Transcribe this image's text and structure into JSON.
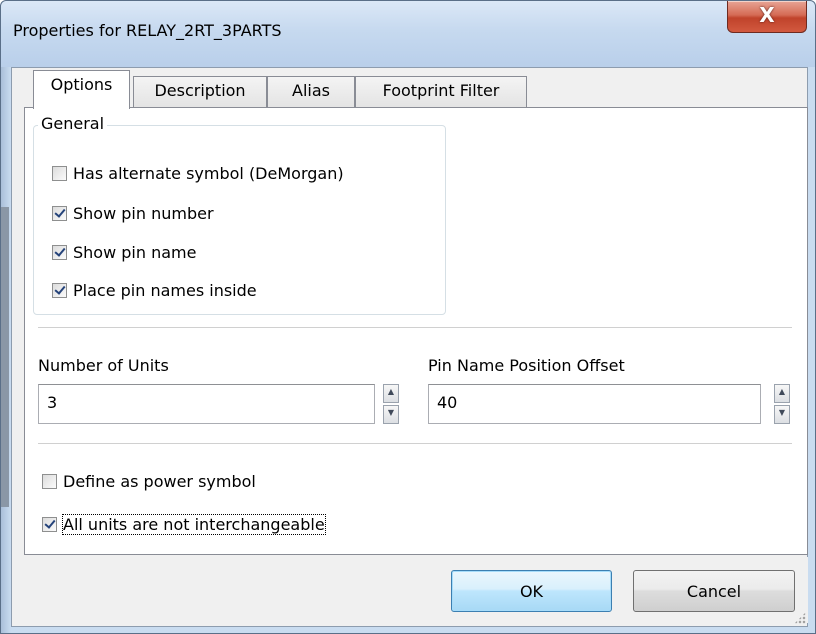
{
  "window": {
    "title": "Properties for RELAY_2RT_3PARTS",
    "close_glyph": "X"
  },
  "tabs": [
    {
      "label": "Options",
      "active": true
    },
    {
      "label": "Description",
      "active": false
    },
    {
      "label": "Alias",
      "active": false
    },
    {
      "label": "Footprint Filter",
      "active": false
    }
  ],
  "general": {
    "group_label": "General",
    "options": [
      {
        "label": "Has alternate symbol (DeMorgan)",
        "checked": false
      },
      {
        "label": "Show pin number",
        "checked": true
      },
      {
        "label": "Show pin name",
        "checked": true
      },
      {
        "label": "Place pin names inside",
        "checked": true
      }
    ]
  },
  "units": {
    "label": "Number of Units",
    "value": "3"
  },
  "pin_offset": {
    "label": "Pin Name Position Offset",
    "value": "40"
  },
  "power": {
    "label": "Define as power symbol",
    "checked": false
  },
  "interchangeable": {
    "label": "All units are not interchangeable",
    "checked": true
  },
  "buttons": {
    "ok": "OK",
    "cancel": "Cancel"
  },
  "icons": {
    "close": "close-icon",
    "spin_up": "spin-up-icon",
    "spin_down": "spin-down-icon",
    "checkmark": "checkmark-icon",
    "resize_grip": "resize-grip-icon"
  }
}
